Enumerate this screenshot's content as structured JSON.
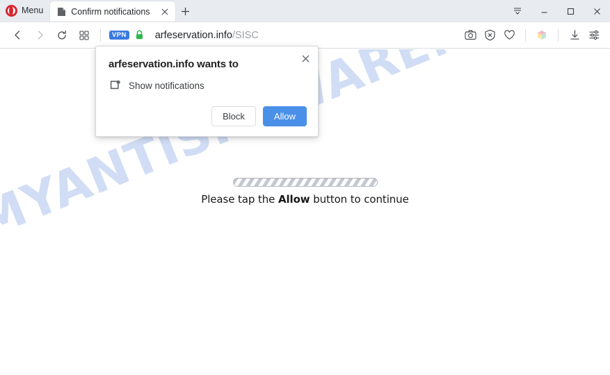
{
  "browser": {
    "name": "Opera",
    "menu_label": "Menu",
    "tabs": [
      {
        "title": "Confirm notifications",
        "favicon": "page-icon",
        "close_label": "✕"
      }
    ],
    "new_tab_label": "+",
    "window_controls": {
      "tab_list_label": "tab-list",
      "minimize_label": "—",
      "maximize_label": "□",
      "close_label": "✕"
    },
    "toolbar": {
      "back_label": "back-icon",
      "forward_label": "forward-icon",
      "reload_label": "reload-icon",
      "speeddial_label": "speed-dial-icon",
      "vpn_badge": "VPN",
      "lock_label": "secure-lock-icon",
      "url_host": "arfeservation.info",
      "url_path": "/SISC",
      "right_icons": [
        "snapshot-camera-icon",
        "ad-blocker-shield-icon",
        "heart-icon",
        "extension-cube-icon",
        "downloads-icon",
        "easy-setup-icon"
      ]
    }
  },
  "dialog": {
    "title": "arfeservation.info wants to",
    "permission_icon": "notifications-icon",
    "permission_label": "Show notifications",
    "block_label": "Block",
    "allow_label": "Allow",
    "close_label": "✕",
    "accent_color": "#4a90e8"
  },
  "page": {
    "watermark": "MYANTISPYWARE.COM",
    "watermark_color": "#cfdcf5",
    "progress_label": "loading-progress",
    "instruction_prefix": "Please tap the ",
    "instruction_emphasis": "Allow",
    "instruction_suffix": " button to continue"
  }
}
